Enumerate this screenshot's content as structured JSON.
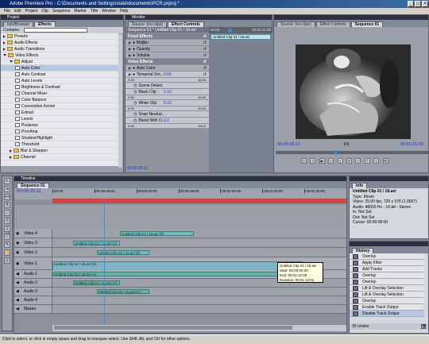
{
  "app": {
    "title": "Adobe Premiere Pro - C:\\Documents and Settings\\state\\documents\\PCR.prproj *"
  },
  "menu": [
    "File",
    "Edit",
    "Project",
    "Clip",
    "Sequence",
    "Marker",
    "Title",
    "Window",
    "Help"
  ],
  "project_panel": {
    "title": "Project",
    "tabs": [
      "Info/Browser",
      "Effects"
    ],
    "contains_label": "Contains:",
    "tree": [
      {
        "label": "Presets",
        "kind": "folder",
        "depth": 0,
        "open": false
      },
      {
        "label": "Audio Effects",
        "kind": "folder",
        "depth": 0,
        "open": false
      },
      {
        "label": "Audio Transitions",
        "kind": "folder",
        "depth": 0,
        "open": false
      },
      {
        "label": "Video Effects",
        "kind": "folder",
        "depth": 0,
        "open": true
      },
      {
        "label": "Adjust",
        "kind": "folder",
        "depth": 1,
        "open": true
      },
      {
        "label": "Auto Color",
        "kind": "fx",
        "depth": 2,
        "selected": true
      },
      {
        "label": "Auto Contrast",
        "kind": "fx",
        "depth": 2
      },
      {
        "label": "Auto Levels",
        "kind": "fx",
        "depth": 2
      },
      {
        "label": "Brightness & Contrast",
        "kind": "fx",
        "depth": 2
      },
      {
        "label": "Channel Mixer",
        "kind": "fx",
        "depth": 2
      },
      {
        "label": "Color Balance",
        "kind": "fx",
        "depth": 2
      },
      {
        "label": "Convolution Kernel",
        "kind": "fx",
        "depth": 2
      },
      {
        "label": "Extract",
        "kind": "fx",
        "depth": 2
      },
      {
        "label": "Levels",
        "kind": "fx",
        "depth": 2
      },
      {
        "label": "Posterize",
        "kind": "fx",
        "depth": 2
      },
      {
        "label": "ProcAmp",
        "kind": "fx",
        "depth": 2
      },
      {
        "label": "Shadow/Highlight",
        "kind": "fx",
        "depth": 2
      },
      {
        "label": "Threshold",
        "kind": "fx",
        "depth": 2
      },
      {
        "label": "Blur & Sharpen",
        "kind": "folder",
        "depth": 1,
        "open": false
      },
      {
        "label": "Channel",
        "kind": "folder",
        "depth": 1,
        "open": false
      }
    ]
  },
  "effect_controls": {
    "title": "Monitor",
    "tabs": [
      "Source: (no clips)",
      "Effect Controls"
    ],
    "header": "Sequence 01 * Untitled Clip 01 / 18.avi",
    "timecode_start": "00:00",
    "timecode_end": "00:00:16:00",
    "clip_label": "Untitled Clip 01 / 18.avi",
    "rows": [
      {
        "label": "Fixed Effects",
        "type": "head"
      },
      {
        "label": "Motion",
        "type": "item",
        "fx": true
      },
      {
        "label": "Opacity",
        "type": "item"
      },
      {
        "label": "Volume",
        "type": "item"
      },
      {
        "label": "Video Effects",
        "type": "head"
      },
      {
        "label": "Auto Color",
        "type": "item"
      },
      {
        "label": "Temporal Sm...",
        "type": "sub",
        "value": "0.00"
      }
    ],
    "params": [
      {
        "label": "Scene Detect",
        "value": ""
      },
      {
        "label": "Black Clip",
        "value": "0.10"
      },
      {
        "label": "White Clip",
        "value": "0.10"
      },
      {
        "label": "Snap Neutral...",
        "value": ""
      },
      {
        "label": "Blend With O...",
        "value": "0.0"
      }
    ],
    "slider_min": "0.00",
    "slider_max_a": "10.00",
    "slider_max_b": "10.00",
    "slider_max_c": "10.00",
    "slider_max_d": "100.0",
    "bottom_timecode": "00:00:20:11"
  },
  "program_monitor": {
    "tabs": [
      "Source: (no clips)",
      "Effect Controls",
      "Sequence 01"
    ],
    "timecode_current": "00:00:20:11",
    "timecode_duration": "00:01:21:03",
    "fit": "Fit"
  },
  "timeline": {
    "title": "Timeline",
    "tabs": [
      "Sequence 01"
    ],
    "timecode": "00:00:20:11",
    "ruler": [
      "00:00",
      "00:00:16:00",
      "00:00:32:00",
      "00:00:48:00",
      "00:01:04:00",
      "00:01:20:00",
      "00:01:36:00"
    ],
    "tracks": [
      {
        "label": "Video 4",
        "clips": [
          {
            "text": "Untitled Clip 01 / 16.avi [V]",
            "start": 0.23,
            "end": 0.48
          }
        ]
      },
      {
        "label": "Video 3",
        "clips": [
          {
            "text": "Untitled Clip 01 / 15.avi [V]",
            "start": 0.07,
            "end": 0.23
          }
        ]
      },
      {
        "label": "Video 2",
        "clips": [
          {
            "text": "Untitled Clip 01 / 11.avi [V]",
            "start": 0.15,
            "end": 0.33
          }
        ]
      },
      {
        "label": "Video 1",
        "clips": [
          {
            "text": "Untitled Clip 01 / 18.avi [V]",
            "start": 0.0,
            "end": 0.85
          }
        ]
      },
      {
        "label": "Audio 1",
        "clips": [
          {
            "text": "Untitled Clip 01 / 18.avi [A]",
            "start": 0.0,
            "end": 0.85
          }
        ]
      },
      {
        "label": "Audio 2",
        "clips": [
          {
            "text": "Untitled Clip 01 / 15.avi [A]",
            "start": 0.07,
            "end": 0.23
          }
        ]
      },
      {
        "label": "Audio 3",
        "clips": [
          {
            "text": "Untitled Clip 01 / 16.avi [A]",
            "start": 0.15,
            "end": 0.33
          }
        ]
      },
      {
        "label": "Audio 4",
        "clips": []
      },
      {
        "label": "Master",
        "clips": []
      }
    ],
    "tooltip": [
      "Untitled Clip 01 / 18.avi",
      "Start: 00:00:00:00",
      "End: 00:01:12:00",
      "Duration: 00:01:13:01"
    ]
  },
  "info_panel": {
    "tabs": [
      "Info"
    ],
    "clip": "Untitled Clip 01 / 18.avi",
    "lines": [
      "Type: Movie",
      "Video: 25.00 fps, 720 x 576 (1.0667)",
      "Audio: 48000 Hz - 16-bit - Stereo",
      "In: Not Set",
      "Out: Not Set",
      "Cursor: 00:00:08:00"
    ]
  },
  "history_panel": {
    "tabs": [
      "History"
    ],
    "items": [
      "Overlay",
      "Apply Filter",
      "Add Tracks",
      "Overlay",
      "Overlay",
      "Lift & Overlay Selection",
      "Lift & Overlay Selection",
      "Overlay",
      "Enable Track Output",
      "Disable Track Output"
    ],
    "footer": "35 Undos"
  },
  "status": "Click to select, or click in empty space and drag to marquee select. Use Shift, Alt, and Ctrl for other options."
}
